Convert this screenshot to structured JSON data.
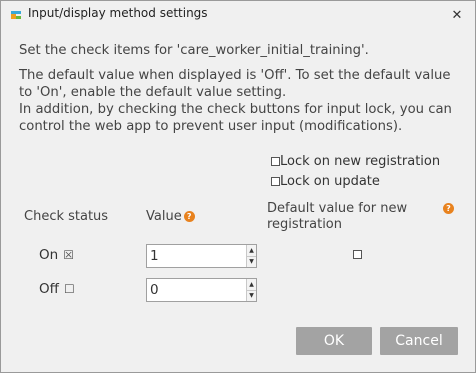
{
  "window": {
    "title": "Input/display method settings",
    "close_glyph": "✕"
  },
  "description": {
    "line1": "Set the check items for 'care_worker_initial_training'.",
    "line2": "The default value when displayed is 'Off'. To set the default value",
    "line3": "to 'On', enable the default value setting.",
    "line4": "In addition, by checking the check buttons for input lock, you can",
    "line5": "control the web app to prevent user input (modifications)."
  },
  "lock_options": [
    {
      "label": "Lock on new registration",
      "checked": false
    },
    {
      "label": "Lock on update",
      "checked": false
    }
  ],
  "columns": {
    "check_status": "Check status",
    "value": "Value",
    "default_line1": "Default value for new",
    "default_line2": "registration",
    "help_glyph": "?"
  },
  "rows": [
    {
      "label": "On",
      "symbol": "☒",
      "value": "1",
      "default_checked": false
    },
    {
      "label": "Off",
      "symbol": "☐",
      "value": "0"
    }
  ],
  "buttons": {
    "ok": "OK",
    "cancel": "Cancel"
  },
  "colors": {
    "help_icon": "#e8821e",
    "button_bg": "#a3a3a3"
  }
}
